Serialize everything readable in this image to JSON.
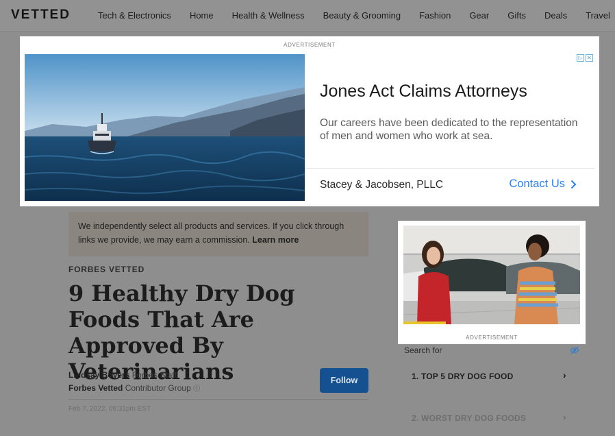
{
  "nav": {
    "logo": "VETTED",
    "items": [
      "Tech & Electronics",
      "Home",
      "Health & Wellness",
      "Beauty & Grooming",
      "Fashion",
      "Gear",
      "Gifts",
      "Deals",
      "Travel"
    ]
  },
  "top_ad": {
    "label": "ADVERTISEMENT",
    "headline": "Jones Act Claims Attorneys",
    "body": "Our careers have been dedicated to the representation of men and women who work at sea.",
    "advertiser": "Stacey & Jacobsen, PLLC",
    "cta": "Contact Us"
  },
  "disclaimer": {
    "text": "We independently select all products and services. If you click through links we provide, we may earn a commission. ",
    "link": "Learn more"
  },
  "article": {
    "kicker": "FORBES VETTED",
    "title": "9 Healthy Dry Dog Foods That Are Approved By Veterinarians",
    "author_name": "Lindsay Boyers",
    "author_role": "Forbes Staff",
    "group_name": "Forbes Vetted",
    "group_role": "Contributor Group",
    "follow_label": "Follow",
    "date": "Feb 7, 2022, 06:31pm EST"
  },
  "side_ad": {
    "label": "ADVERTISEMENT"
  },
  "search": {
    "label": "Search for",
    "items": [
      "1. TOP 5 DRY DOG FOOD",
      "2. WORST DRY DOG FOODS"
    ]
  },
  "colors": {
    "follow_button": "#155191",
    "ad_cta": "#2d7ff0"
  }
}
